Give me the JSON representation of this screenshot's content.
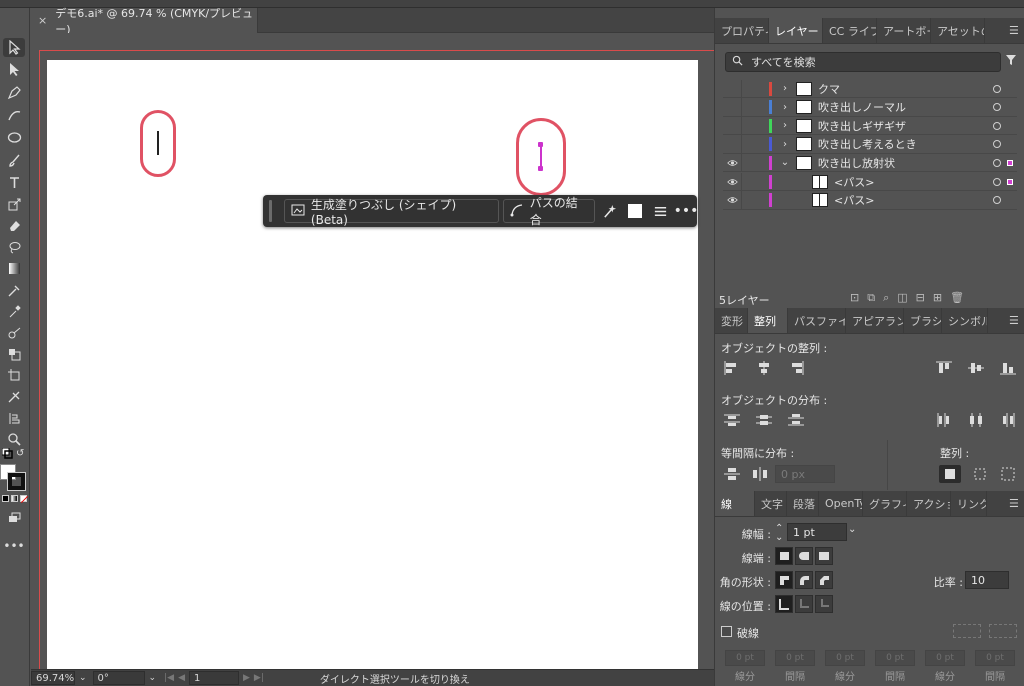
{
  "document_tab": {
    "close": "×",
    "title": "デモ6.ai* @ 69.74 % (CMYK/プレビュー)"
  },
  "context_bar": {
    "generative_fill": "生成塗りつぶし (シェイプ) (Beta)",
    "combine_paths": "パスの結合"
  },
  "status_bar": {
    "zoom": "69.74%",
    "rotation": "0°",
    "artboard": "1",
    "tool_hint": "ダイレクト選択ツールを切り換え"
  },
  "layers_panel": {
    "tabs": [
      "プロパティ",
      "レイヤー",
      "CC ライブ",
      "アートボー",
      "アセットの"
    ],
    "active_tab": "レイヤー",
    "search_placeholder": "すべてを検索",
    "rows": [
      {
        "name": "クマ",
        "color": "#d9493f",
        "visible": false,
        "expanded": false,
        "indent": 0
      },
      {
        "name": "吹き出しノーマル",
        "color": "#4a7fd4",
        "visible": false,
        "expanded": false,
        "indent": 0
      },
      {
        "name": "吹き出しギザギザ",
        "color": "#3fd65a",
        "visible": false,
        "expanded": false,
        "indent": 0
      },
      {
        "name": "吹き出し考えるとき",
        "color": "#4a5ad4",
        "visible": false,
        "expanded": false,
        "indent": 0
      },
      {
        "name": "吹き出し放射状",
        "color": "#d040d0",
        "visible": true,
        "expanded": true,
        "indent": 0
      },
      {
        "name": "<パス>",
        "color": "#d040d0",
        "visible": true,
        "expanded": false,
        "indent": 1
      },
      {
        "name": "<パス>",
        "color": "#d040d0",
        "visible": true,
        "expanded": false,
        "indent": 1
      }
    ],
    "layer_count": "5レイヤー"
  },
  "align_panel": {
    "tabs": [
      "変形",
      "整列",
      "パスファイ",
      "アピアラン",
      "ブラシ",
      "シンボル"
    ],
    "active_tab": "整列",
    "align_objects": "オブジェクトの整列 :",
    "distribute_objects": "オブジェクトの分布 :",
    "distribute_spacing": "等間隔に分布 :",
    "align_to": "整列 :",
    "spacing_value": "0 px"
  },
  "stroke_panel": {
    "tabs": [
      "線",
      "文字",
      "段落",
      "OpenTy",
      "グラフィ",
      "アクショ",
      "リンク"
    ],
    "active_tab": "線",
    "weight_label": "線幅 :",
    "weight_value": "1 pt",
    "cap_label": "線端 :",
    "corner_label": "角の形状 :",
    "limit_label": "比率 :",
    "limit_value": "10",
    "align_label": "線の位置 :",
    "dashed_label": "破線",
    "dash_labels": [
      "線分",
      "間隔",
      "線分",
      "間隔",
      "線分",
      "間隔"
    ],
    "dash_value": "0 pt"
  },
  "colors": {
    "accent_selection": "#cc33cc",
    "bubble": "#e05264",
    "bleed": "#d94b4b"
  }
}
